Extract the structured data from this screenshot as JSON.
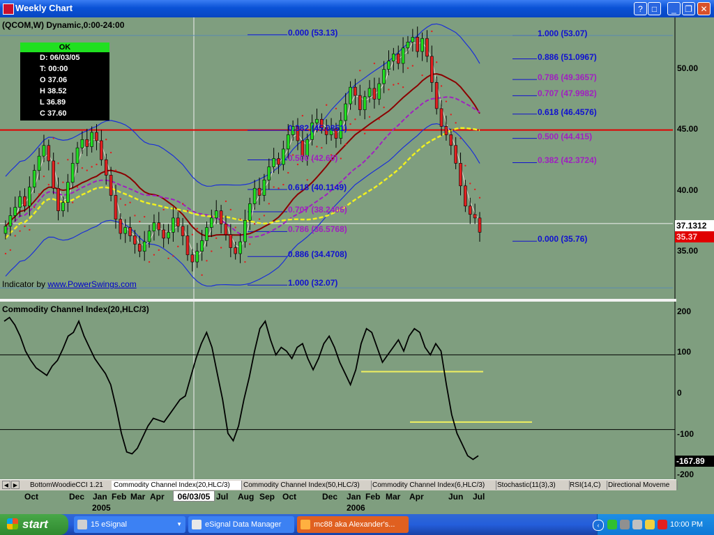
{
  "window": {
    "title": "Weekly Chart"
  },
  "chart_header": "(QCOM,W) Dynamic,0:00-24:00",
  "info_box": {
    "status": "OK",
    "date": "D: 06/03/05",
    "time": "T: 00:00",
    "open": "O 37.06",
    "high": "H 38.52",
    "low": "L 36.89",
    "close": "C 37.60"
  },
  "indicator_credit": {
    "prefix": "Indicator by ",
    "link": "www.PowerSwings.com"
  },
  "cci_title": "Commodity Channel Index(20,HLC/3)",
  "fib_labels": [
    {
      "text": "0.000 (53.13)",
      "color": "#1010d0"
    },
    {
      "text": "0.382 (45.0851)",
      "color": "#1010d0"
    },
    {
      "text": "0.500 (42.60)",
      "color": "#a020c0"
    },
    {
      "text": "0.618 (40.1149)",
      "color": "#1010d0"
    },
    {
      "text": "0.707 (38.2406)",
      "color": "#a020c0"
    },
    {
      "text": "0.786 (36.5768)",
      "color": "#a020c0"
    },
    {
      "text": "0.886 (34.4708)",
      "color": "#1010d0"
    },
    {
      "text": "1.000 (32.07)",
      "color": "#1010d0"
    },
    {
      "text": "1.000 (53.07)",
      "color": "#1010d0"
    },
    {
      "text": "0.886 (51.0967)",
      "color": "#1010d0"
    },
    {
      "text": "0.786 (49.3657)",
      "color": "#a020c0"
    },
    {
      "text": "0.707 (47.9982)",
      "color": "#a020c0"
    },
    {
      "text": "0.618 (46.4576)",
      "color": "#1010d0"
    },
    {
      "text": "0.500 (44.415)",
      "color": "#a020c0"
    },
    {
      "text": "0.382 (42.3724)",
      "color": "#a020c0"
    },
    {
      "text": "0.000 (35.76)",
      "color": "#1010d0"
    }
  ],
  "price_axis": [
    "50.00",
    "45.00",
    "40.00",
    "35.00"
  ],
  "last_price": "37.1312",
  "price_marker": "35.37",
  "cci_axis": [
    "200",
    "100",
    "0",
    "-100",
    "-200"
  ],
  "cci_last": "-167.89",
  "tabs": [
    "BottomWoodieCCI 1.21",
    "Commodity Channel Index(20,HLC/3)",
    "Commodity Channel Index(50,HLC/3)",
    "Commodity Channel Index(6,HLC/3)",
    "Stochastic(11(3),3)",
    "RSI(14,C)",
    "Directional Moveme"
  ],
  "x_months": [
    "Oct",
    "Dec",
    "Jan",
    "Feb",
    "Mar",
    "Apr",
    "Jul",
    "Aug",
    "Sep",
    "Oct",
    "Dec",
    "Jan",
    "Feb",
    "Mar",
    "Apr",
    "Jun",
    "Jul"
  ],
  "x_years": [
    "2005",
    "2006"
  ],
  "cursor_date": "06/03/05",
  "taskbar": {
    "start": "start",
    "items": [
      "15 eSignal",
      "eSignal Data Manager",
      "mc88 aka Alexander's..."
    ],
    "clock": "10:00 PM"
  },
  "colors": {
    "background": "#7f9e7f",
    "bollinger": "#1a2fd8",
    "ma_red": "#8b0000",
    "ma_magenta": "#a020c0",
    "ma_yellow": "#f0f020",
    "sar": "#e02020",
    "resistance": "#e00000",
    "cci": "#000000"
  },
  "chart_data": [
    {
      "type": "candlestick",
      "title": "(QCOM,W) Dynamic,0:00-24:00",
      "ylim": [
        31.5,
        54
      ],
      "y_ticks": [
        35,
        40,
        45,
        50
      ],
      "horizontal_line": 45,
      "closes": [
        36.9,
        37.8,
        38.5,
        39.4,
        38.6,
        40.2,
        41.6,
        42.8,
        43.7,
        42.4,
        40.1,
        38.2,
        38.9,
        40.6,
        42.2,
        43.5,
        44.2,
        43.6,
        44.8,
        44.1,
        42.5,
        41.2,
        39.5,
        37.5,
        36.3,
        36.8,
        36.1,
        35.4,
        34.8,
        35.6,
        36.5,
        37.2,
        36.6,
        35.9,
        36.4,
        37.6,
        36.9,
        36.1,
        34.5,
        33.9,
        34.8,
        35.7,
        36.8,
        37.6,
        38.2,
        37.1,
        36.2,
        35.1,
        34.6,
        35.6,
        37.4,
        38.8,
        40.1,
        39.5,
        40.8,
        41.9,
        42.6,
        42.1,
        43.4,
        44.6,
        45.3,
        44.1,
        42.8,
        44.2,
        45.6,
        45.9,
        45.2,
        44.6,
        45.1,
        44.3,
        45.8,
        47.2,
        48.6,
        47.9,
        46.7,
        47.8,
        48.5,
        47.6,
        48.9,
        50.1,
        50.8,
        51.4,
        50.6,
        51.9,
        52.4,
        52.8,
        51.6,
        52.7,
        51.2,
        49.0,
        46.8,
        45.3,
        44.6,
        43.7,
        42.2,
        40.3,
        38.6,
        37.9,
        37.6,
        36.4
      ]
    },
    {
      "type": "line",
      "title": "Commodity Channel Index(20,HLC/3)",
      "ylim": [
        -220,
        220
      ],
      "y_ticks": [
        -200,
        -100,
        0,
        100,
        200
      ],
      "values": [
        190,
        200,
        180,
        150,
        110,
        85,
        65,
        55,
        45,
        70,
        85,
        115,
        150,
        160,
        190,
        150,
        120,
        90,
        70,
        50,
        20,
        -40,
        -110,
        -160,
        -165,
        -150,
        -120,
        -90,
        -70,
        -75,
        -80,
        -60,
        -40,
        -20,
        -10,
        40,
        90,
        130,
        160,
        120,
        50,
        -20,
        -110,
        -130,
        -90,
        -20,
        40,
        110,
        170,
        190,
        140,
        100,
        120,
        110,
        90,
        120,
        130,
        90,
        60,
        90,
        130,
        150,
        120,
        80,
        50,
        20,
        60,
        130,
        170,
        160,
        120,
        80,
        100,
        120,
        140,
        110,
        150,
        170,
        160,
        120,
        100,
        130,
        110,
        20,
        -60,
        -110,
        -140,
        -170,
        -180,
        -170
      ]
    }
  ]
}
